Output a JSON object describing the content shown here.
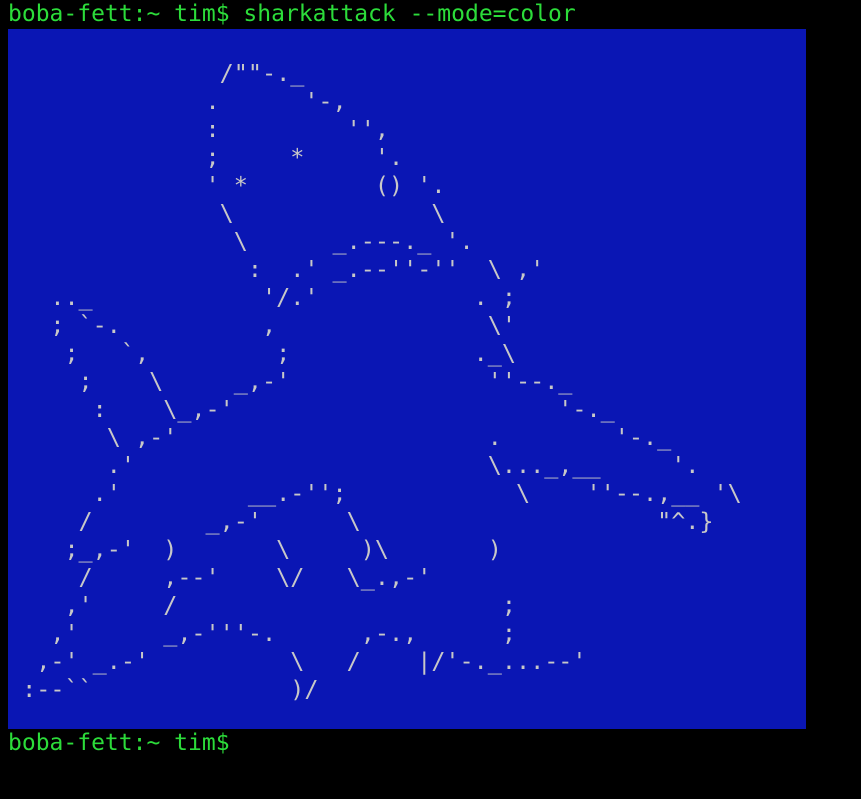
{
  "terminal": {
    "prompt": "boba-fett:~ tim$",
    "command": "sharkattack --mode=color",
    "bottom_prompt": "boba-fett:~ tim$"
  },
  "colors": {
    "terminal_background": "#000000",
    "prompt_green": "#2cdc3a",
    "art_background": "#0a16b4",
    "art_foreground": "#c8c8c8"
  },
  "ascii_art": {
    "lines": [
      "               /\"\"-._",
      "              .      '-,",
      "              :         '',",
      "              ;     *     '.",
      "              ' *         () '.",
      "               \\              \\",
      "                \\      _.---._ '.",
      "                 :  .' _.--''-''  \\ ,'",
      "   .._            '/.'           . ;",
      "   ; `-.          ,               \\'",
      "    ;   `,         ;             ._\\",
      "     ;    \\     _,-'              ''--._",
      "      :    \\_,-'                       '-._",
      "       \\ ,-'                      .        '-._",
      "       .'                         \\..._,__     '.",
      "      .'         __.-'';            \\    ''--.,__ '\\",
      "     /        _,-'      \\                     \"^.}",
      "    ;_,-'  )       \\     )\\       )",
      "     /     ,--'    \\/   \\_.,-'",
      "    ,'     /                       ;",
      "   ,'      _,-'''-.      ,-.,      ;",
      "  ,-' _.-'          \\   /    |/'-._...--'",
      " :--``              )/"
    ]
  }
}
